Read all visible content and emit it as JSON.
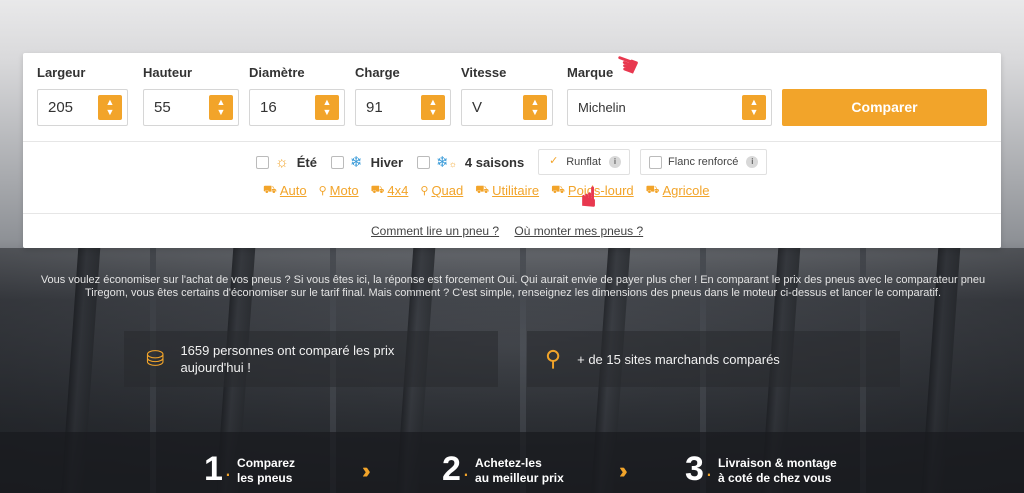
{
  "form": {
    "fields": [
      {
        "label": "Largeur",
        "value": "205"
      },
      {
        "label": "Hauteur",
        "value": "55"
      },
      {
        "label": "Diamètre",
        "value": "16"
      },
      {
        "label": "Charge",
        "value": "91"
      },
      {
        "label": "Vitesse",
        "value": "V"
      },
      {
        "label": "Marque",
        "value": "Michelin"
      }
    ],
    "compare_label": "Comparer"
  },
  "seasons": [
    {
      "label": "Été",
      "icon": "sun-icon"
    },
    {
      "label": "Hiver",
      "icon": "snowflake-icon"
    },
    {
      "label": "4 saisons",
      "icon": "all-season-icon"
    }
  ],
  "options": [
    {
      "label": "Runflat",
      "checked": true
    },
    {
      "label": "Flanc renforcé",
      "checked": false
    }
  ],
  "vehicles": [
    {
      "label": "Auto",
      "icon": "car-icon"
    },
    {
      "label": "Moto",
      "icon": "motorcycle-icon"
    },
    {
      "label": "4x4",
      "icon": "suv-icon"
    },
    {
      "label": "Quad",
      "icon": "quad-icon"
    },
    {
      "label": "Utilitaire",
      "icon": "van-icon"
    },
    {
      "label": "Poids-lourd",
      "icon": "truck-icon"
    },
    {
      "label": "Agricole",
      "icon": "tractor-icon"
    }
  ],
  "help_links": [
    "Comment lire un pneu ?",
    "Où monter mes pneus ?"
  ],
  "intro_text": "Vous voulez économiser sur l'achat de vos pneus ? Si vous êtes ici, la réponse est forcement Oui. Qui aurait envie de payer plus cher ! En comparant le prix des pneus avec le comparateur pneu Tiregom, vous êtes certains d'économiser sur le tarif final. Mais comment ? C'est simple, renseignez les dimensions des pneus dans le moteur ci-dessus et lancer le comparatif.",
  "stats": [
    {
      "text": "1659 personnes ont comparé les prix aujourd'hui !",
      "icon": "coins-icon"
    },
    {
      "text": "+ de 15 sites marchands comparés",
      "icon": "compare-search-icon"
    }
  ],
  "steps": [
    {
      "num": "1",
      "line1": "Comparez",
      "line2": "les pneus"
    },
    {
      "num": "2",
      "line1": "Achetez-les",
      "line2": "au meilleur prix"
    },
    {
      "num": "3",
      "line1": "Livraison & montage",
      "line2": "à coté de chez vous"
    }
  ],
  "colors": {
    "accent": "#f2a42a",
    "cursor": "#e8384f"
  }
}
